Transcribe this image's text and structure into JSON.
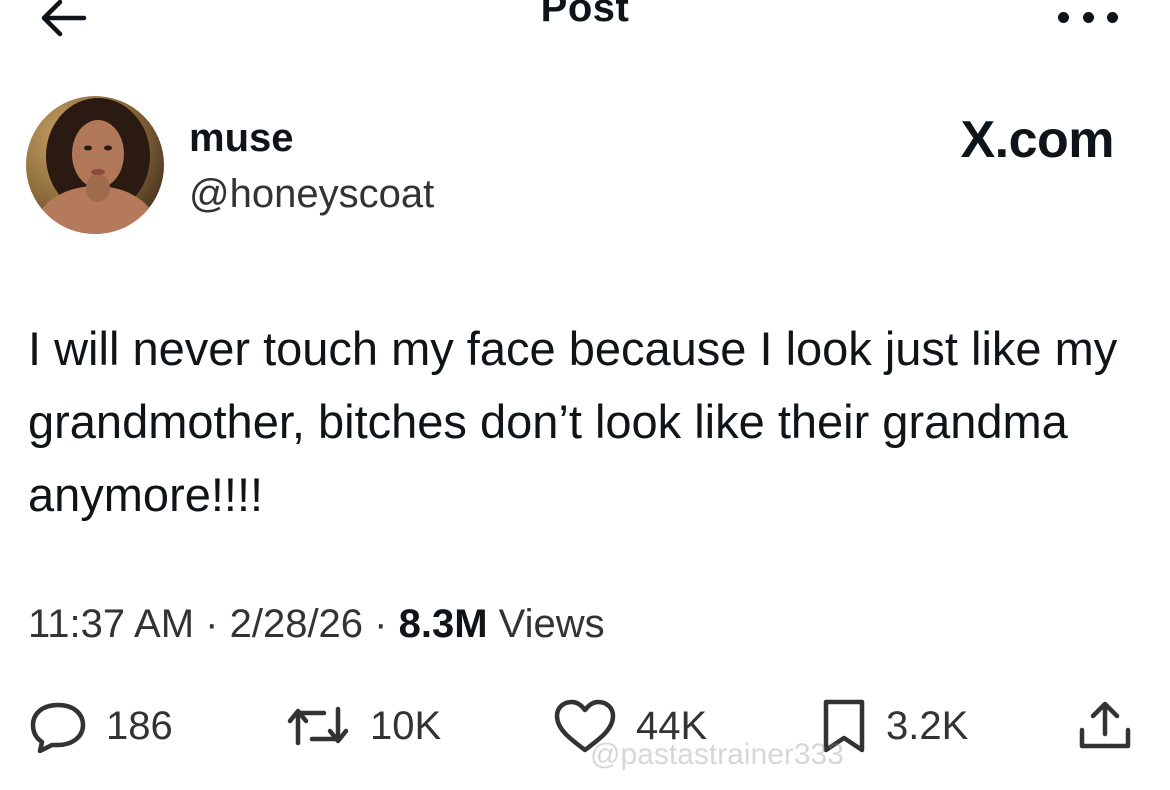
{
  "header": {
    "title": "Post",
    "back_icon": "arrow-left-icon",
    "more_icon": "more-horizontal-icon"
  },
  "author": {
    "display_name": "muse",
    "handle": "@honeyscoat",
    "source": "X.com"
  },
  "tweet": {
    "text": "I will never touch my face because I look just like my grandmother, bitches don’t look like their grandma anymore!!!!"
  },
  "meta": {
    "time": "11:37 AM",
    "separator": " · ",
    "date": "2/28/26",
    "views_count": "8.3M",
    "views_label": " Views"
  },
  "actions": {
    "replies": "186",
    "reposts": "10K",
    "likes": "44K",
    "bookmarks": "3.2K"
  },
  "watermark": "@pastastrainer333"
}
